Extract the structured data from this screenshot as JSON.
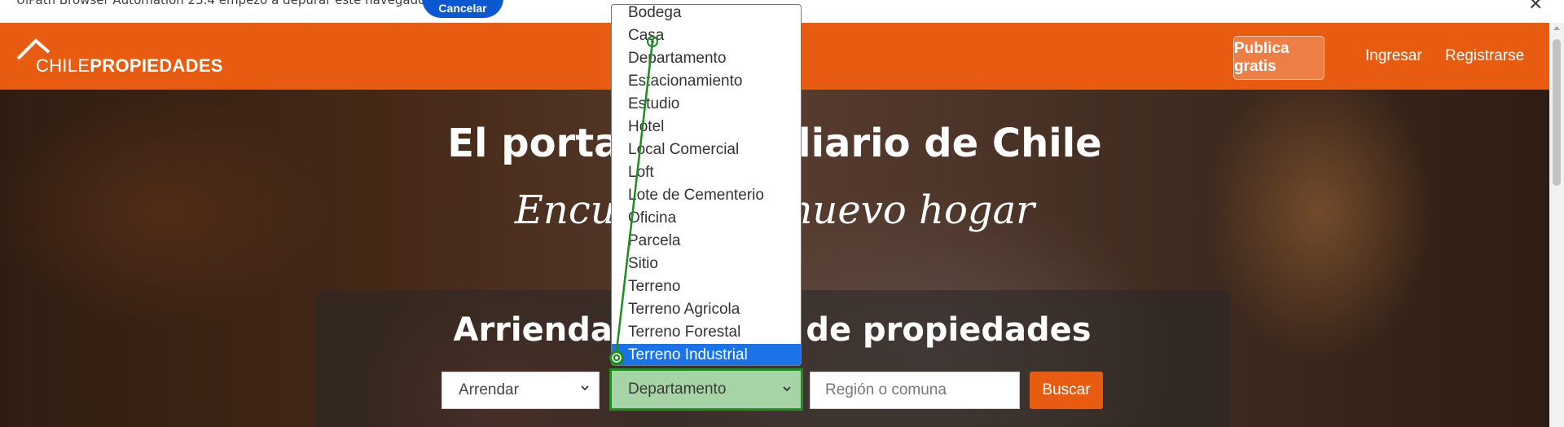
{
  "infobar": {
    "message": "UiPath Browser Automation 23.4 empezó a depurar este navegador",
    "cancel_label": "Cancelar",
    "close_glyph": "✕"
  },
  "header": {
    "logo_light": "CHILE",
    "logo_bold": "PROPIEDADES",
    "publish_label": "Publica gratis",
    "login_label": "Ingresar",
    "register_label": "Registrarse",
    "brand_color": "#e85c12"
  },
  "hero": {
    "title": "El portal inmobiliario de Chile",
    "subtitle": "Encuentra tu nuevo hogar",
    "search_heading": "Arrienda o compra de propiedades"
  },
  "search": {
    "operation_value": "Arrendar",
    "type_value": "Departamento",
    "region_placeholder": "Región o comuna",
    "search_label": "Buscar"
  },
  "dropdown": {
    "options": [
      "Bodega",
      "Casa",
      "Departamento",
      "Estacionamiento",
      "Estudio",
      "Hotel",
      "Local Comercial",
      "Loft",
      "Lote de Cementerio",
      "Oficina",
      "Parcela",
      "Sitio",
      "Terreno",
      "Terreno Agricola",
      "Terreno Forestal",
      "Terreno Industrial"
    ],
    "highlighted": "Terreno Industrial",
    "highlight_color": "#1a73e8"
  }
}
